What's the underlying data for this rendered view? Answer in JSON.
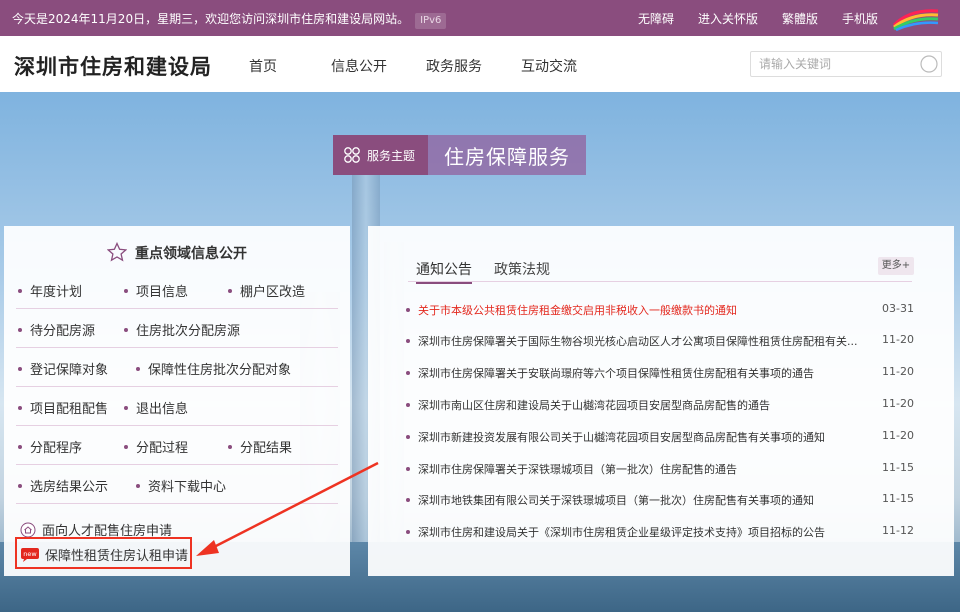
{
  "topbar": {
    "welcome": "今天是2024年11月20日，星期三，欢迎您访问深圳市住房和建设局网站。",
    "ipv6": "IPv6",
    "links": [
      "无障碍",
      "进入关怀版",
      "繁體版",
      "手机版"
    ],
    "accent": "#8a4d7e"
  },
  "header": {
    "site_title": "深圳市住房和建设局",
    "nav": [
      "首页",
      "信息公开",
      "政务服务",
      "互动交流"
    ],
    "search_placeholder": "请输入关键词"
  },
  "theme": {
    "tag": "服务主题",
    "name": "住房保障服务"
  },
  "left_panel": {
    "title": "重点领域信息公开",
    "rows": [
      [
        "年度计划",
        "项目信息",
        "棚户区改造"
      ],
      [
        "待分配房源",
        "住房批次分配房源"
      ],
      [
        "登记保障对象",
        "保障性住房批次分配对象"
      ],
      [
        "项目配租配售",
        "退出信息"
      ],
      [
        "分配程序",
        "分配过程",
        "分配结果"
      ],
      [
        "选房结果公示",
        "资料下载中心"
      ]
    ],
    "special": [
      {
        "label": "面向人才配售住房申请",
        "icon": "house-icon"
      },
      {
        "label": "保障性租赁住房认租申请",
        "icon": "new-badge-icon",
        "badge": "new"
      }
    ]
  },
  "right_panel": {
    "tabs": [
      "通知公告",
      "政策法规"
    ],
    "more": "更多+",
    "news": [
      {
        "title": "关于市本级公共租赁住房租金缴交启用非税收入一般缴款书的通知",
        "date": "03-31",
        "highlight": true
      },
      {
        "title": "深圳市住房保障署关于国际生物谷坝光核心启动区人才公寓项目保障性租赁住房配租有关...",
        "date": "11-20"
      },
      {
        "title": "深圳市住房保障署关于安联尚璟府等六个项目保障性租赁住房配租有关事项的通告",
        "date": "11-20"
      },
      {
        "title": "深圳市南山区住房和建设局关于山樾湾花园项目安居型商品房配售的通告",
        "date": "11-20"
      },
      {
        "title": "深圳市新建投资发展有限公司关于山樾湾花园项目安居型商品房配售有关事项的通知",
        "date": "11-20"
      },
      {
        "title": "深圳市住房保障署关于深铁璟城项目（第一批次）住房配售的通告",
        "date": "11-15"
      },
      {
        "title": "深圳市地铁集团有限公司关于深铁璟城项目（第一批次）住房配售有关事项的通知",
        "date": "11-15"
      },
      {
        "title": "深圳市住房和建设局关于《深圳市住房租赁企业星级评定技术支持》项目招标的公告",
        "date": "11-12"
      }
    ]
  }
}
